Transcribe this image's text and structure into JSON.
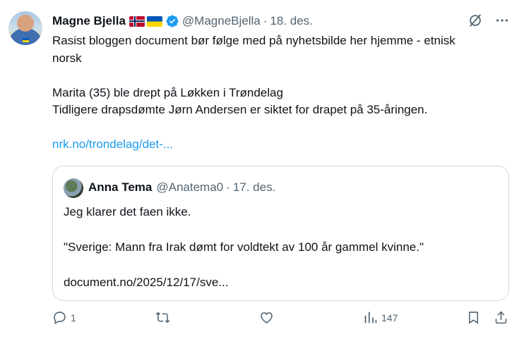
{
  "author": {
    "name": "Magne Bjella",
    "handle": "@MagneBjella",
    "date": "18. des."
  },
  "post": {
    "line1": "Rasist bloggen document bør følge med på nyhetsbilde her hjemme - etnisk norsk",
    "line2": "Marita (35) ble drept på Løkken i Trøndelag",
    "line3": "Tidligere drapsdømte Jørn Andersen er siktet for drapet på 35-åringen.",
    "link": "nrk.no/trondelag/det-..."
  },
  "quote": {
    "name": "Anna Tema",
    "handle": "@Anatema0",
    "date": "17. des.",
    "line1": "Jeg klarer det faen ikke.",
    "line2": "\"Sverige: Mann fra Irak dømt for voldtekt av 100 år gammel kvinne.\"",
    "link": "document.no/2025/12/17/sve..."
  },
  "actions": {
    "replies": "1",
    "reposts": "",
    "likes": "",
    "views": "147"
  },
  "colors": {
    "text": "#0f1419",
    "muted": "#536471",
    "link": "#1d9bf0",
    "verified": "#1d9bf0",
    "border": "#cfd9de"
  },
  "dot": "·"
}
